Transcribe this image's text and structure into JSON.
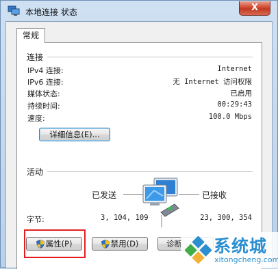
{
  "window": {
    "title": "本地连接 状态",
    "close_label": "X"
  },
  "tabs": [
    {
      "label": "常规"
    }
  ],
  "connection": {
    "group_label": "连接",
    "rows": [
      {
        "label": "IPv4 连接:",
        "value": "Internet"
      },
      {
        "label": "IPv6 连接:",
        "value": "无 Internet 访问权限"
      },
      {
        "label": "媒体状态:",
        "value": "已启用"
      },
      {
        "label": "持续时间:",
        "value": "00:29:43"
      },
      {
        "label": "速度:",
        "value": "100.0 Mbps"
      }
    ],
    "details_button": "详细信息(E)..."
  },
  "activity": {
    "group_label": "活动",
    "sent_label": "已发送",
    "received_label": "已接收",
    "bytes_label": "字节:",
    "bytes_sent": "3, 104, 109",
    "bytes_received": "23, 300, 354"
  },
  "buttons": {
    "properties": "属性(P)",
    "disable": "禁用(D)",
    "diagnose": "诊断"
  },
  "watermark": {
    "name": "系统城",
    "url": "xitongcheng.com"
  },
  "colors": {
    "highlight_box": "#e41e1e",
    "watermark": "#2b8fd0"
  }
}
